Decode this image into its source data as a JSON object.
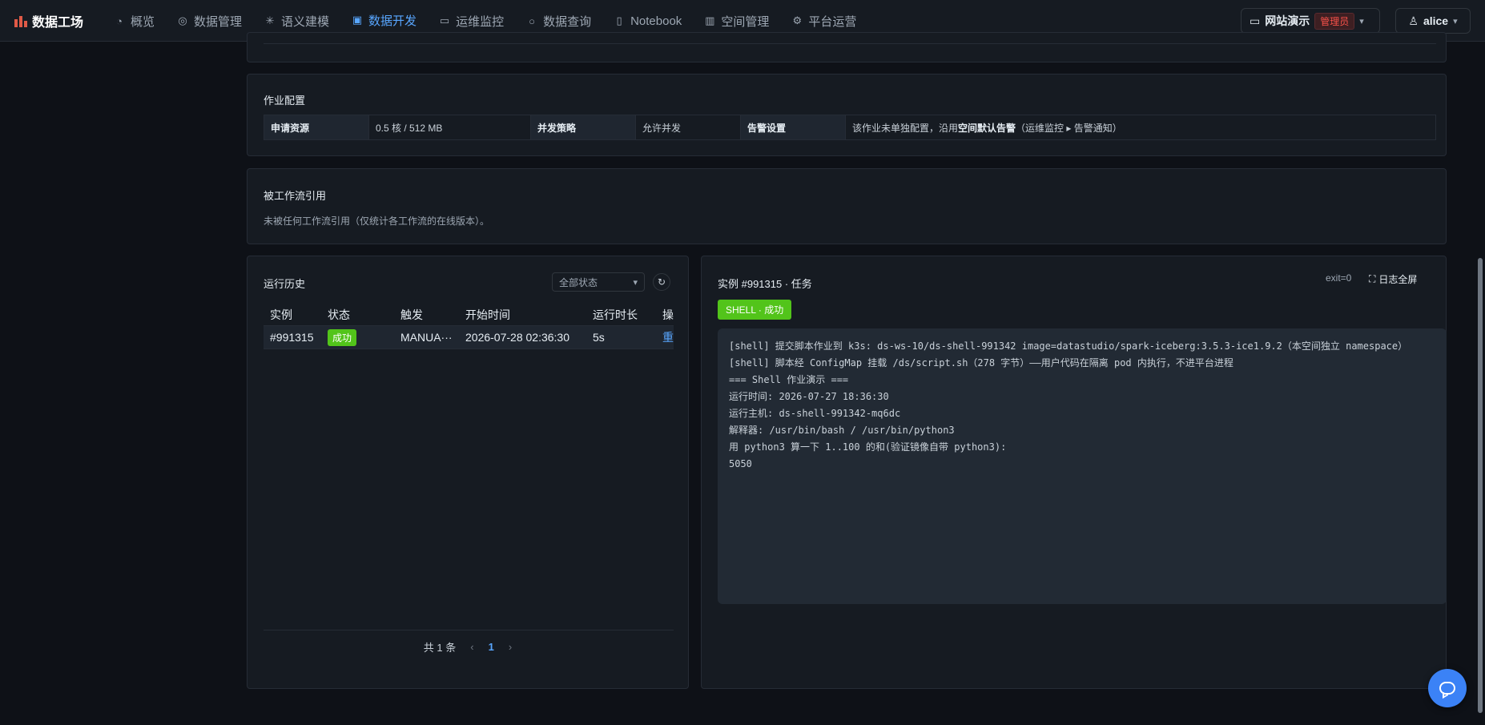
{
  "app": {
    "brand": "数据工场"
  },
  "nav": {
    "items": [
      {
        "label": "概览",
        "icon": "dashboard-icon",
        "glyph": "◔"
      },
      {
        "label": "数据管理",
        "icon": "database-icon",
        "glyph": "◎"
      },
      {
        "label": "语义建模",
        "icon": "sparkle-icon",
        "glyph": "✳"
      },
      {
        "label": "数据开发",
        "icon": "code-file-icon",
        "glyph": "▣",
        "active": true
      },
      {
        "label": "运维监控",
        "icon": "monitor-icon",
        "glyph": "▭"
      },
      {
        "label": "数据查询",
        "icon": "search-icon",
        "glyph": "○"
      },
      {
        "label": "Notebook",
        "icon": "notebook-icon",
        "glyph": "▯"
      },
      {
        "label": "空间管理",
        "icon": "building-icon",
        "glyph": "▥"
      },
      {
        "label": "平台运营",
        "icon": "gear-icon",
        "glyph": "⚙"
      }
    ]
  },
  "header": {
    "site_label": "网站演示",
    "role_badge": "管理员",
    "user_name": "alice"
  },
  "job_config": {
    "title": "作业配置",
    "cells": [
      {
        "key": "申请资源",
        "value": "0.5 核 / 512 MB"
      },
      {
        "key": "并发策略",
        "value": "允许并发"
      },
      {
        "key": "告警设置",
        "value_prefix": "该作业未单独配置，沿用",
        "value_bold": "空间默认告警",
        "value_suffix": "（运维监控 ▸ 告警通知）"
      }
    ]
  },
  "workflow_refs": {
    "title": "被工作流引用",
    "text": "未被任何工作流引用（仅统计各工作流的在线版本）。"
  },
  "run_history": {
    "title": "运行历史",
    "filter_value": "全部状态",
    "columns": [
      "实例",
      "状态",
      "触发",
      "开始时间",
      "运行时长",
      "操"
    ],
    "rows": [
      {
        "instance": "#991315",
        "status": "成功",
        "trigger": "MANUA···",
        "start": "2026-07-28 02:36:30",
        "duration": "5s",
        "action": "重"
      }
    ],
    "total": "共 1 条",
    "page": "1"
  },
  "instance_log": {
    "title": "实例 #991315 · 任务",
    "exit": "exit=0",
    "fullscreen_label": "日志全屏",
    "badge": "SHELL · 成功",
    "lines": [
      "[shell] 提交脚本作业到 k3s: ds-ws-10/ds-shell-991342 image=datastudio/spark-iceberg:3.5.3-ice1.9.2（本空间独立 namespace）",
      "[shell] 脚本经 ConfigMap 挂载 /ds/script.sh（278 字节）——用户代码在隔离 pod 内执行，不进平台进程",
      "=== Shell 作业演示 ===",
      "运行时间: 2026-07-27 18:36:30",
      "运行主机: ds-shell-991342-mq6dc",
      "解释器: /usr/bin/bash / /usr/bin/python3",
      "用 python3 算一下 1..100 的和(验证镜像自带 python3):",
      "5050"
    ]
  },
  "colors": {
    "accent": "#58a6ff",
    "success": "#52c41a",
    "danger": "#f85149"
  }
}
